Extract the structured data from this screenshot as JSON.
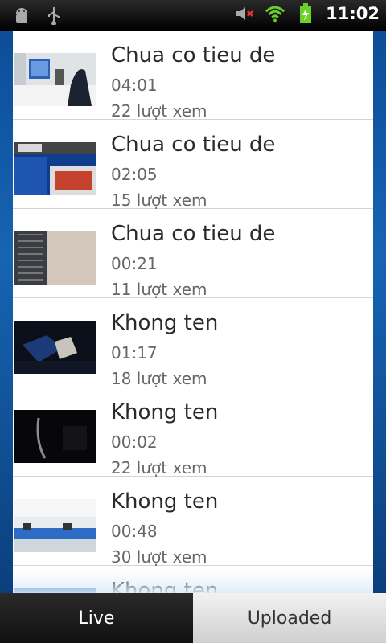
{
  "status_bar": {
    "icons_left": [
      "android-debug-icon",
      "usb-icon"
    ],
    "icons_right": [
      "mute-icon",
      "wifi-icon",
      "battery-charging-icon"
    ],
    "time": "11:02"
  },
  "videos": [
    {
      "title": "Chua co tieu de",
      "duration": "04:01",
      "views": "22 lượt xem",
      "thumb": "office-desk"
    },
    {
      "title": "Chua co tieu de",
      "duration": "02:05",
      "views": "15 lượt xem",
      "thumb": "blue-cubicle"
    },
    {
      "title": "Chua co tieu de",
      "duration": "00:21",
      "views": "11 lượt xem",
      "thumb": "keyboard"
    },
    {
      "title": "Khong ten",
      "duration": "01:17",
      "views": "18 lượt xem",
      "thumb": "dark-blue"
    },
    {
      "title": "Khong ten",
      "duration": "00:02",
      "views": "22 lượt xem",
      "thumb": "dark"
    },
    {
      "title": "Khong ten",
      "duration": "00:48",
      "views": "30 lượt xem",
      "thumb": "open-office"
    },
    {
      "title": "Khong ten",
      "duration": "",
      "views": "",
      "thumb": "partial"
    }
  ],
  "tabs": {
    "live": "Live",
    "uploaded": "Uploaded",
    "selected": "live"
  },
  "colors": {
    "status_bar": "#000000",
    "wallpaper": "#1664b3",
    "list_bg": "#ffffff"
  }
}
